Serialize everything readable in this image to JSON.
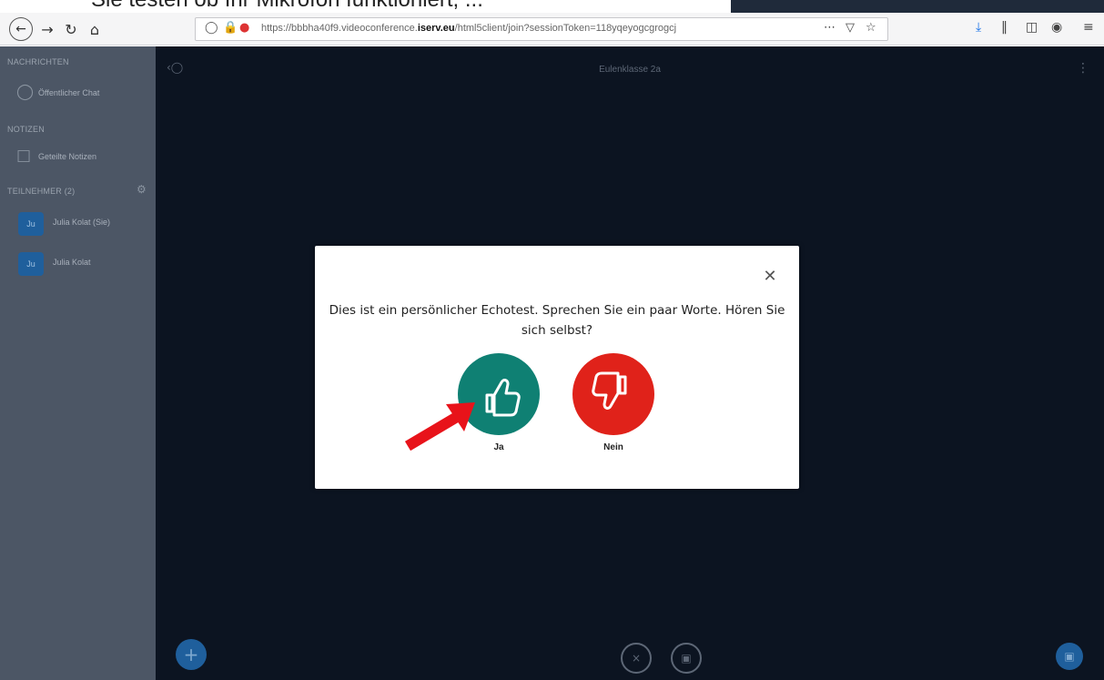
{
  "caption": {
    "text": "Sie testen ob Ihr Mikrofon funktioniert; ..."
  },
  "browser": {
    "url_prefix": "https://bbbha40f9.videoconference.",
    "url_domain": "iserv.eu",
    "url_suffix": "/html5client/join?sessionToken=118yqeyogcgrogcj"
  },
  "sidebar": {
    "section_messages": "NACHRICHTEN",
    "public_chat": "Öffentlicher Chat",
    "section_notes": "NOTIZEN",
    "shared_notes": "Geteilte Notizen",
    "section_participants": "TEILNEHMER (2)",
    "participants": [
      {
        "initials": "Ju",
        "name": "Julia Kolat (Sie)"
      },
      {
        "initials": "Ju",
        "name": "Julia Kolat"
      }
    ]
  },
  "stage": {
    "title": "Eulenklasse 2a"
  },
  "modal": {
    "text": "Dies ist ein persönlicher Echotest. Sprechen Sie ein paar Worte. Hören Sie sich selbst?",
    "yes_label": "Ja",
    "no_label": "Nein"
  },
  "colors": {
    "yes": "#0f8073",
    "no": "#e0221a",
    "arrow": "#e8131a"
  }
}
